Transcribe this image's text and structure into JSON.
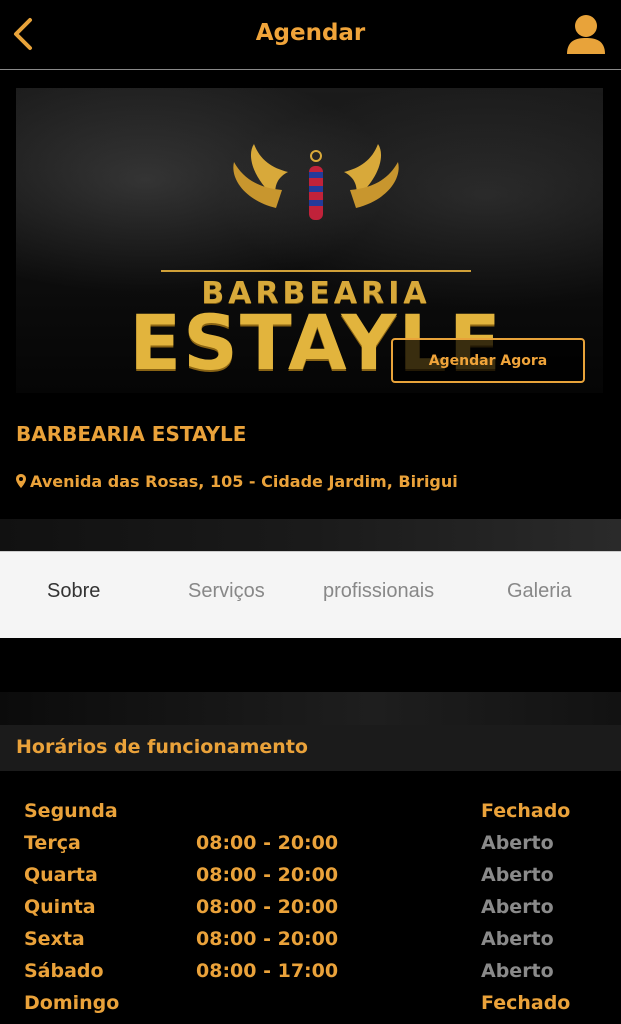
{
  "header": {
    "title": "Agendar",
    "back_icon": "chevron-left-icon",
    "profile_icon": "user-icon"
  },
  "banner": {
    "logo_line1": "BARBEARIA",
    "logo_line2": "ESTAYLE",
    "cta_label": "Agendar Agora"
  },
  "shop": {
    "name": "BARBEARIA ESTAYLE",
    "address": "Avenida das Rosas, 105 - Cidade Jardim, Birigui"
  },
  "tabs": [
    {
      "label": "Sobre",
      "active": true
    },
    {
      "label": "Serviços",
      "active": false
    },
    {
      "label": "profissionais",
      "active": false
    },
    {
      "label": "Galeria",
      "active": false
    }
  ],
  "hours": {
    "title": "Horários de funcionamento",
    "rows": [
      {
        "day": "Segunda",
        "time": "",
        "status": "Fechado",
        "open": false
      },
      {
        "day": "Terça",
        "time": "08:00 - 20:00",
        "status": "Aberto",
        "open": true
      },
      {
        "day": "Quarta",
        "time": "08:00 - 20:00",
        "status": "Aberto",
        "open": true
      },
      {
        "day": "Quinta",
        "time": "08:00 - 20:00",
        "status": "Aberto",
        "open": true
      },
      {
        "day": "Sexta",
        "time": "08:00 - 20:00",
        "status": "Aberto",
        "open": true
      },
      {
        "day": "Sábado",
        "time": "08:00 - 17:00",
        "status": "Aberto",
        "open": true
      },
      {
        "day": "Domingo",
        "time": "",
        "status": "Fechado",
        "open": false
      }
    ]
  },
  "colors": {
    "accent": "#eaa23a",
    "open_status": "#8a8a8a",
    "tabs_bg": "#f5f5f5"
  }
}
